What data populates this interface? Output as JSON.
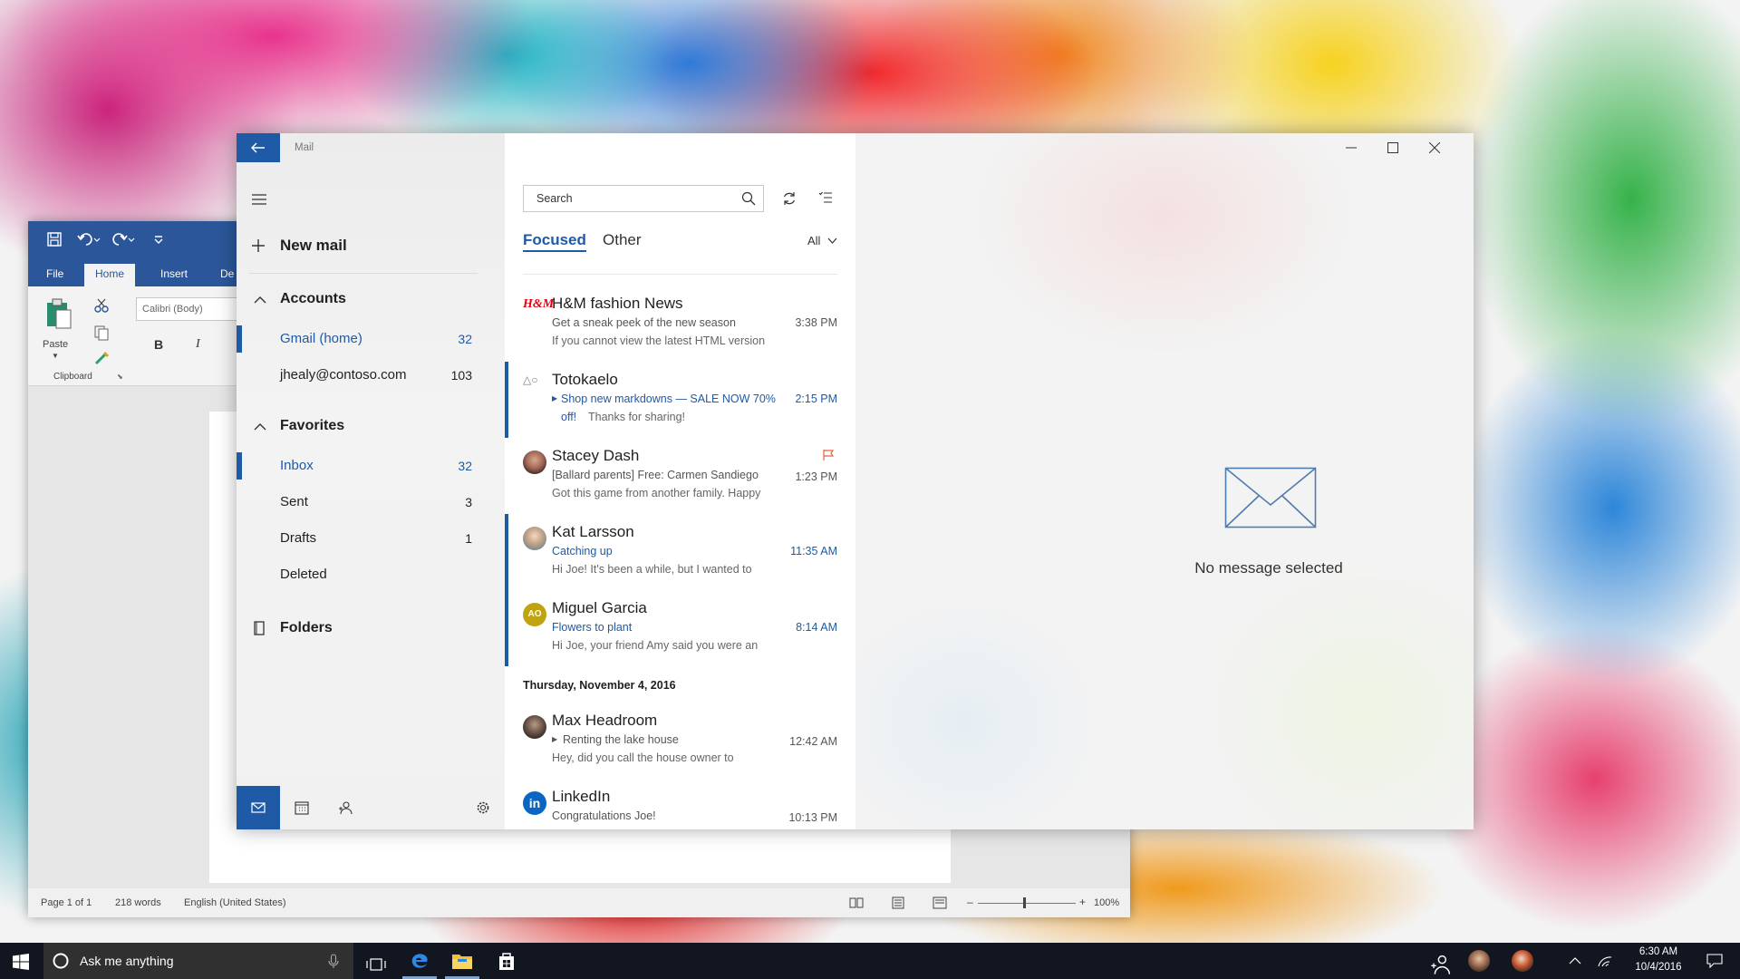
{
  "word": {
    "tabs": [
      "File",
      "Home",
      "Insert",
      "De"
    ],
    "font_box": "Calibri (Body)",
    "paste_label": "Paste",
    "clipboard_label": "Clipboard",
    "bold": "B",
    "italic": "I",
    "status": {
      "page": "Page 1 of 1",
      "words": "218 words",
      "language": "English (United States)",
      "zoom": "100%"
    }
  },
  "mail": {
    "title": "Mail",
    "new_mail": "New mail",
    "accounts_header": "Accounts",
    "accounts": [
      {
        "name": "Gmail (home)",
        "count": "32"
      },
      {
        "name": "jhealy@contoso.com",
        "count": "103"
      }
    ],
    "favorites_header": "Favorites",
    "favorites": [
      {
        "name": "Inbox",
        "count": "32"
      },
      {
        "name": "Sent",
        "count": "3"
      },
      {
        "name": "Drafts",
        "count": "1"
      },
      {
        "name": "Deleted",
        "count": ""
      }
    ],
    "folders_label": "Folders",
    "search_placeholder": "Search",
    "tabs": {
      "focused": "Focused",
      "other": "Other",
      "filter": "All"
    },
    "messages": [
      {
        "sender": "H&M fashion News",
        "subject": "Get a sneak peek of the new season",
        "preview": "If you cannot view the latest HTML version",
        "time": "3:38 PM",
        "logo": "H&M"
      },
      {
        "sender": "Totokaelo",
        "subject": "Shop new markdowns — SALE NOW 70%",
        "preview_a": "off!",
        "preview_b": "Thanks for sharing!",
        "time": "2:15 PM",
        "logo": "△○"
      },
      {
        "sender": "Stacey Dash",
        "subject": "[Ballard parents] Free: Carmen Sandiego",
        "preview": "Got this game from another family. Happy",
        "time": "1:23 PM"
      },
      {
        "sender": "Kat Larsson",
        "subject": "Catching up",
        "preview": "Hi Joe! It's been a while, but I wanted to",
        "time": "11:35 AM"
      },
      {
        "sender": "Miguel Garcia",
        "subject": "Flowers to plant",
        "preview": "Hi Joe, your friend Amy said you were an",
        "time": "8:14 AM",
        "initials": "AO"
      }
    ],
    "date_header": "Thursday, November 4, 2016",
    "older_messages": [
      {
        "sender": "Max Headroom",
        "subject": "Renting the lake house",
        "preview": "Hey, did you call the house owner to",
        "time": "12:42 AM"
      },
      {
        "sender": "LinkedIn",
        "subject": "Congratulations Joe!",
        "time": "10:13 PM",
        "logo": "in"
      }
    ],
    "empty_state": "No message selected"
  },
  "taskbar": {
    "search_text": "Ask me anything",
    "time": "6:30 AM",
    "date": "10/4/2016"
  },
  "colors": {
    "accent": "#1e5aa6",
    "word_blue": "#2b579a",
    "flag": "#e8623a"
  }
}
